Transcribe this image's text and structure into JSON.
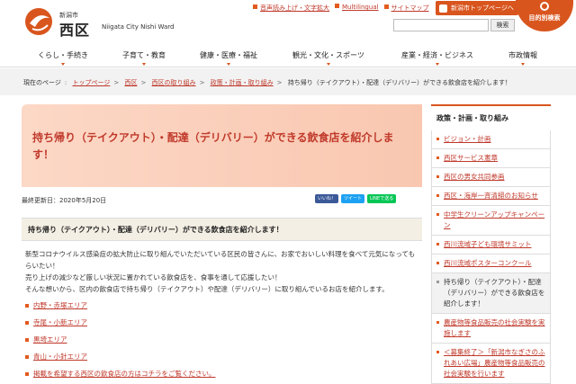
{
  "header": {
    "logo_small": "新潟市",
    "logo_big": "西区",
    "logo_en": "Niigata City Nishi Ward",
    "toplinks": [
      "音声読み上げ・文字拡大",
      "Multilingual",
      "サイトマップ"
    ],
    "top_button": "新潟市トップページへ",
    "circle_button": "目的別検索",
    "search_placeholder": "",
    "search_button": "検索"
  },
  "gnav": [
    "くらし・手続き",
    "子育て・教育",
    "健康・医療・福祉",
    "観光・文化・スポーツ",
    "産業・経済・ビジネス",
    "市政情報"
  ],
  "breadcrumb": {
    "current_label": "現在のページ",
    "items": [
      "トップページ",
      "西区",
      "西区の取り組み",
      "政策・計画・取り組み"
    ],
    "current": "持ち帰り（テイクアウト）・配達（デリバリー）ができる飲食店を紹介します！"
  },
  "main": {
    "title": "持ち帰り（テイクアウト）・配達（デリバリー）ができる飲食店を紹介します！",
    "updated": "最終更新日：2020年5月20日",
    "share": [
      "いいね！",
      "ツイート",
      "LINEで送る"
    ],
    "h2": "持ち帰り（テイクアウト）・配達（デリバリー）ができる飲食店を紹介します！",
    "paragraphs": [
      "新型コロナウイルス感染症の拡大防止に取り組んでいただいている区民の皆さんに、お家でおいしい料理を食べて元気になってもらいたい！",
      "売り上げの減少など厳しい状況に置かれている飲食店を、食事を通して応援したい！",
      "そんな想いから、区内の飲食店で持ち帰り（テイクアウト）や配達（デリバリー）に取り組んでいるお店を紹介します。"
    ],
    "links": [
      "内野・赤塚エリア",
      "寺尾・小新エリア",
      "黒埼エリア",
      "青山・小針エリア",
      "掲載を希望する西区の飲食店の方はコチラをご覧ください。"
    ]
  },
  "sidebar": {
    "heading": "政策・計画・取り組み",
    "items": [
      {
        "label": "ビジョン・計画",
        "current": false
      },
      {
        "label": "西区サービス憲章",
        "current": false
      },
      {
        "label": "西区の男女共同参画",
        "current": false
      },
      {
        "label": "西区・海岸一斉清掃のお知らせ",
        "current": false
      },
      {
        "label": "中学生クリーンアップキャンペーン",
        "current": false
      },
      {
        "label": "西川流域子ども環境サミット",
        "current": false
      },
      {
        "label": "西川流域ポスターコンクール",
        "current": false
      },
      {
        "label": "持ち帰り（テイクアウト）・配達（デリバリー）ができる飲食店を紹介します！",
        "current": true
      },
      {
        "label": "農産物等食品販売の社会実験を実施します",
        "current": false
      },
      {
        "label": "＜募集終了＞「新潟市なぎさのふれあい広場」農産物等食品販売の社会実験を行います",
        "current": false
      }
    ]
  },
  "colors": {
    "accent": "#d9551e",
    "link": "#c0392b",
    "title_bg": "#fcd8c6"
  }
}
